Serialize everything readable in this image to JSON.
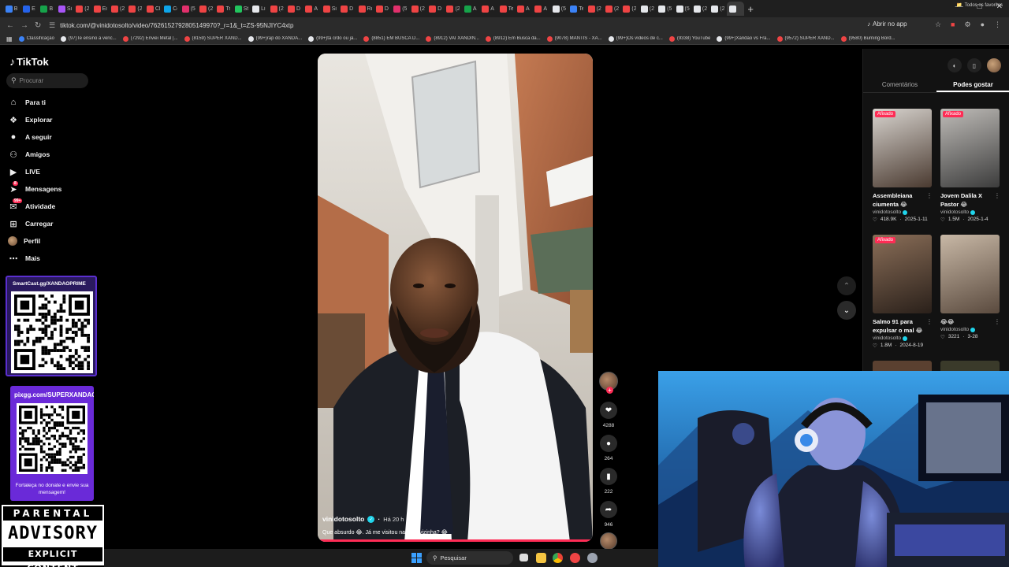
{
  "browser": {
    "tabs": [
      {
        "letter": "B",
        "color": "#3b82f6"
      },
      {
        "letter": "E",
        "color": "#2563eb"
      },
      {
        "letter": "B",
        "color": "#16a34a"
      },
      {
        "letter": "Si",
        "color": "#a855f7"
      },
      {
        "letter": "(2",
        "color": "#ef4444"
      },
      {
        "letter": "Ei",
        "color": "#ef4444"
      },
      {
        "letter": "(2",
        "color": "#ef4444"
      },
      {
        "letter": "(2",
        "color": "#ef4444"
      },
      {
        "letter": "Cl",
        "color": "#ef4444"
      },
      {
        "letter": "Cc",
        "color": "#0ea5e9"
      },
      {
        "letter": "(5",
        "color": "#e1306c"
      },
      {
        "letter": "(2",
        "color": "#ef4444"
      },
      {
        "letter": "Tr",
        "color": "#ef4444"
      },
      {
        "letter": "St",
        "color": "#22c55e"
      },
      {
        "letter": "Li",
        "color": "#e5e7eb"
      },
      {
        "letter": "(2",
        "color": "#ef4444"
      },
      {
        "letter": "D",
        "color": "#ef4444"
      },
      {
        "letter": "A",
        "color": "#ef4444"
      },
      {
        "letter": "Si",
        "color": "#ef4444"
      },
      {
        "letter": "D",
        "color": "#ef4444"
      },
      {
        "letter": "Rı",
        "color": "#ef4444"
      },
      {
        "letter": "D",
        "color": "#ef4444"
      },
      {
        "letter": "(5",
        "color": "#e1306c"
      },
      {
        "letter": "(2",
        "color": "#ef4444"
      },
      {
        "letter": "D",
        "color": "#ef4444"
      },
      {
        "letter": "(2",
        "color": "#ef4444"
      },
      {
        "letter": "A",
        "color": "#16a34a"
      },
      {
        "letter": "A",
        "color": "#ef4444"
      },
      {
        "letter": "Te",
        "color": "#ef4444"
      },
      {
        "letter": "A",
        "color": "#ef4444"
      },
      {
        "letter": "A",
        "color": "#ef4444"
      },
      {
        "letter": "(5",
        "color": "#e5e7eb"
      },
      {
        "letter": "Te",
        "color": "#3b82f6"
      },
      {
        "letter": "(2",
        "color": "#ef4444"
      },
      {
        "letter": "(2",
        "color": "#ef4444"
      },
      {
        "letter": "(2",
        "color": "#ef4444"
      },
      {
        "letter": "(2",
        "color": "#e5e7eb"
      },
      {
        "letter": "(5",
        "color": "#e5e7eb"
      },
      {
        "letter": "(5",
        "color": "#e5e7eb"
      },
      {
        "letter": "(2",
        "color": "#e5e7eb"
      },
      {
        "letter": "(2",
        "color": "#e5e7eb"
      },
      {
        "letter": "",
        "color": "#e5e7eb"
      }
    ],
    "url": "tiktok.com/@vinidotosolto/video/7626152792805149970?_r=1&_t=ZS-95NJIYC4xtp",
    "open_in_app": "Abrir no app",
    "bookmarks": [
      {
        "label": "Classificação",
        "color": "#3b82f6"
      },
      {
        "label": "(97)Te ensino a venc...",
        "color": "#e5e7eb"
      },
      {
        "label": "(7292) Enviei Metal |...",
        "color": "#ef4444"
      },
      {
        "label": "(8159) SUPER XAND...",
        "color": "#ef4444"
      },
      {
        "label": "(99+)rap do XANDÃ...",
        "color": "#e5e7eb"
      },
      {
        "label": "(99+)tá crdo ou já...",
        "color": "#e5e7eb"
      },
      {
        "label": "(8851) EM BUSCA D...",
        "color": "#ef4444"
      },
      {
        "label": "(8912) VAI XANDIN...",
        "color": "#ef4444"
      },
      {
        "label": "(8912) Em Busca da...",
        "color": "#ef4444"
      },
      {
        "label": "(9078) MANTIS - XA...",
        "color": "#ef4444"
      },
      {
        "label": "(99+)Os vídeos de c...",
        "color": "#e5e7eb"
      },
      {
        "label": "(9338) YouTube",
        "color": "#ef4444"
      },
      {
        "label": "(99+)Xandão vs Fra...",
        "color": "#e5e7eb"
      },
      {
        "label": "(9572) SUPER XAND...",
        "color": "#ef4444"
      },
      {
        "label": "(9580) Burning Bord...",
        "color": "#ef4444"
      }
    ],
    "all_favorites": "Todos os favoritos"
  },
  "sidebar": {
    "logo": "TikTok",
    "search_placeholder": "Procurar",
    "items": [
      {
        "label": "Para ti",
        "icon": "home-icon"
      },
      {
        "label": "Explorar",
        "icon": "compass-icon"
      },
      {
        "label": "A seguir",
        "icon": "following-icon"
      },
      {
        "label": "Amigos",
        "icon": "friends-icon"
      },
      {
        "label": "LIVE",
        "icon": "live-icon"
      },
      {
        "label": "Mensagens",
        "icon": "messages-icon",
        "badge": "8"
      },
      {
        "label": "Atividade",
        "icon": "activity-icon",
        "badge": "99+"
      },
      {
        "label": "Carregar",
        "icon": "upload-icon"
      },
      {
        "label": "Perfil",
        "icon": "avatar"
      },
      {
        "label": "Mais",
        "icon": "more-icon"
      }
    ]
  },
  "overlays": {
    "smartcast_title": "SmartCast.gg/XANDAOPRIME",
    "pixgg_title": "pixgg.com/SUPERXANDAO",
    "pixgg_message": "Fortaleça no donate e envie sua mensagem!",
    "advisory_top": "PARENTAL",
    "advisory_mid": "ADVISORY",
    "advisory_bot": "EXPLICIT CONTENT"
  },
  "video": {
    "username": "vinidotosolto",
    "time": "Há 20 h",
    "caption": "Que absurdo 😂. Já me visitou na rede vizinha? 😂",
    "progress": 0.99
  },
  "actions": {
    "likes": "4288",
    "comments": "264",
    "saves": "222",
    "shares": "946"
  },
  "right_panel": {
    "tab_comments": "Comentários",
    "tab_suggested": "Podes gostar",
    "pinned_label": "Afixado",
    "recommendations": [
      {
        "title": "Assembleiana ciumenta 😂",
        "author": "vinidotosolto",
        "views": "418.9K",
        "date": "2025-1-11",
        "pinned": true,
        "thumb": [
          "#d8d4cf",
          "#4a3a30"
        ]
      },
      {
        "title": "Jovem Dalila X Pastor 😂",
        "author": "vinidotosolto",
        "views": "1.5M",
        "date": "2025-1-4",
        "pinned": true,
        "thumb": [
          "#bfbcb8",
          "#3c3c3c"
        ]
      },
      {
        "title": "Salmo 91 para expulsar o mal 😂",
        "author": "vinidotosolto",
        "views": "1.8M",
        "date": "2024-8-19",
        "pinned": true,
        "thumb": [
          "#8a6e58",
          "#2a201a"
        ]
      },
      {
        "title": "😂😂",
        "author": "vinidotosolto",
        "views": "3221",
        "date": "3-28",
        "pinned": false,
        "thumb": [
          "#c8b8a6",
          "#5a4a3e"
        ]
      }
    ]
  },
  "taskbar": {
    "search_label": "Pesquisar"
  }
}
